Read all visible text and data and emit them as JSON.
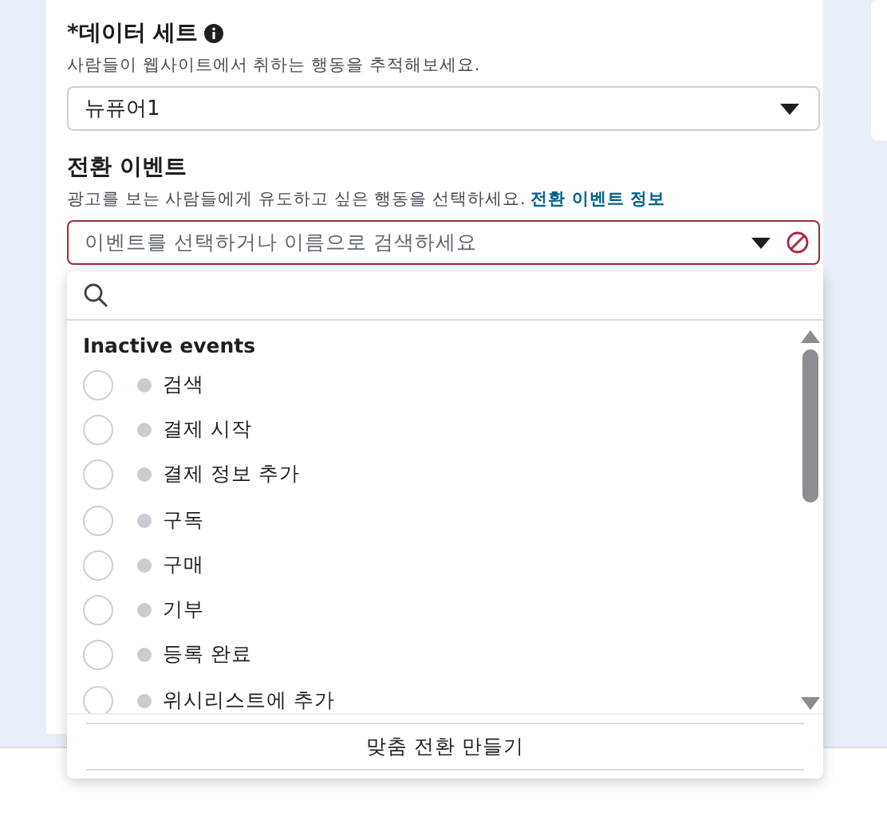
{
  "dataset": {
    "required_mark": "*",
    "label": "데이터 세트",
    "description": "사람들이 웹사이트에서 취하는 행동을 추적해보세요.",
    "value": "뉴퓨어1"
  },
  "conversion_event": {
    "label": "전환 이벤트",
    "description": "광고를 보는 사람들에게 유도하고 싶은 행동을 선택하세요.",
    "link": "전환 이벤트 정보",
    "placeholder": "이벤트를 선택하거나 이름으로 검색하세요",
    "error": true
  },
  "dropdown": {
    "section": "Inactive events",
    "items": [
      {
        "label": "검색",
        "selected": false,
        "active": false
      },
      {
        "label": "결제 시작",
        "selected": false,
        "active": false
      },
      {
        "label": "결제 정보 추가",
        "selected": false,
        "active": false
      },
      {
        "label": "구독",
        "selected": false,
        "active": false
      },
      {
        "label": "구매",
        "selected": false,
        "active": false
      },
      {
        "label": "기부",
        "selected": false,
        "active": false
      },
      {
        "label": "등록 완료",
        "selected": false,
        "active": false
      },
      {
        "label": "위시리스트에 추가",
        "selected": false,
        "active": false
      }
    ],
    "footer_button": "맞춤 전환 만들기"
  }
}
